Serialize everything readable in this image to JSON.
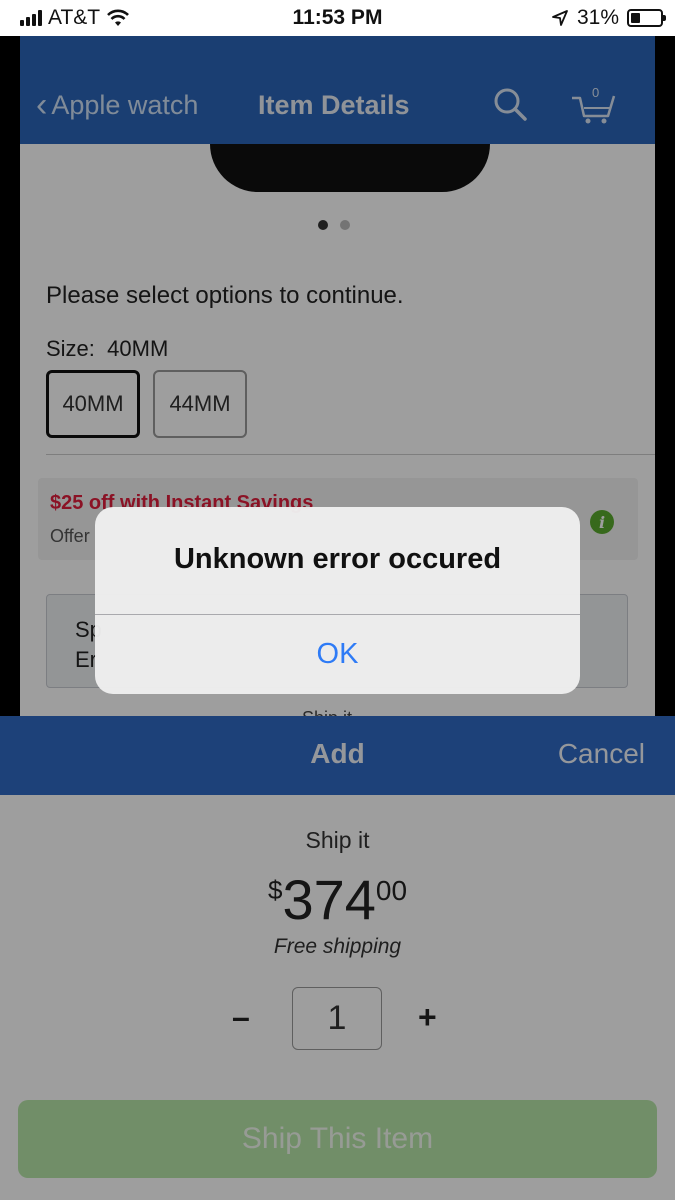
{
  "status_bar": {
    "carrier": "AT&T",
    "time": "11:53 PM",
    "battery_percent": "31%",
    "battery_level": 0.31,
    "icons": [
      "signal-bars-icon",
      "wifi-icon",
      "location-arrow-icon",
      "battery-icon"
    ]
  },
  "header": {
    "back_label": "Apple watch",
    "title": "Item Details",
    "cart_count": "0",
    "icons": [
      "chevron-left-icon",
      "search-icon",
      "cart-icon"
    ],
    "color": "#2a65b8"
  },
  "product": {
    "options_prompt": "Please select options to continue.",
    "size_label": "Size:",
    "size_value": "40MM",
    "sizes": [
      "40MM",
      "44MM"
    ],
    "promo_title": "$25 off with Instant Savings",
    "promo_sub": "Offer",
    "promo_color": "#e01e3c",
    "grey_box_line1": "Sp",
    "grey_box_line2": "Er",
    "peek_text": "Ship it"
  },
  "sheet": {
    "title": "Add",
    "cancel_label": "Cancel",
    "ship_label": "Ship it",
    "price_currency": "$",
    "price_dollars": "374",
    "price_cents": "00",
    "shipping_note": "Free shipping",
    "quantity": "1",
    "minus_label": "–",
    "plus_label": "+",
    "ship_button_label": "Ship This Item",
    "ship_button_color": "#b6e6a8"
  },
  "alert": {
    "title": "Unknown error occured",
    "ok_label": "OK",
    "ok_color": "#2e7bf6"
  }
}
